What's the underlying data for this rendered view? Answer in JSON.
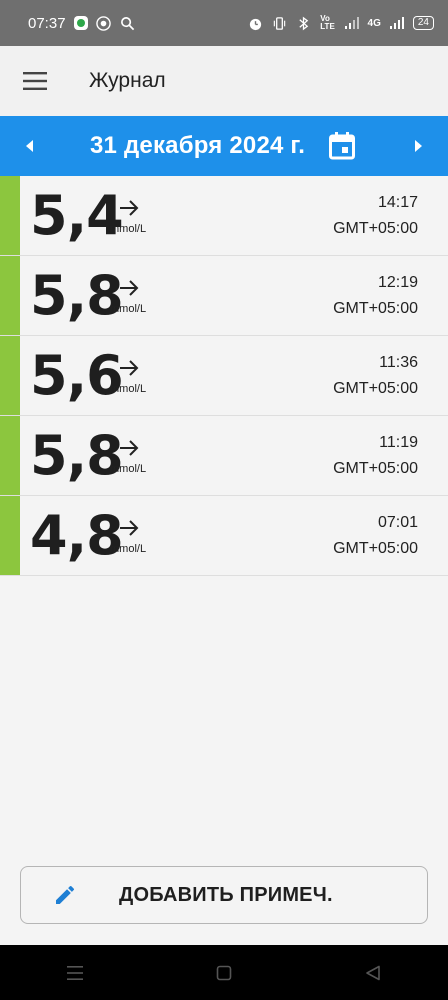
{
  "status_bar": {
    "time": "07:37",
    "battery": "24",
    "network": "4G"
  },
  "header": {
    "title": "Журнал"
  },
  "date_bar": {
    "date": "31 декабря 2024 г."
  },
  "entries": [
    {
      "value": "5,4",
      "unit": "mmol/L",
      "time": "14:17",
      "timezone": "GMT+05:00",
      "trend": "flat"
    },
    {
      "value": "5,8",
      "unit": "mmol/L",
      "time": "12:19",
      "timezone": "GMT+05:00",
      "trend": "flat"
    },
    {
      "value": "5,6",
      "unit": "mmol/L",
      "time": "11:36",
      "timezone": "GMT+05:00",
      "trend": "flat"
    },
    {
      "value": "5,8",
      "unit": "mmol/L",
      "time": "11:19",
      "timezone": "GMT+05:00",
      "trend": "flat"
    },
    {
      "value": "4,8",
      "unit": "mmol/L",
      "time": "07:01",
      "timezone": "GMT+05:00",
      "trend": "flat"
    }
  ],
  "add_note": {
    "label": "ДОБАВИТЬ ПРИМЕЧ."
  },
  "colors": {
    "accent": "#1e90ea",
    "in_range": "#8cc63e"
  },
  "icons": [
    "menu-icon",
    "prev-day-icon",
    "calendar-icon",
    "next-day-icon",
    "trend-arrow-icon",
    "pencil-icon"
  ]
}
